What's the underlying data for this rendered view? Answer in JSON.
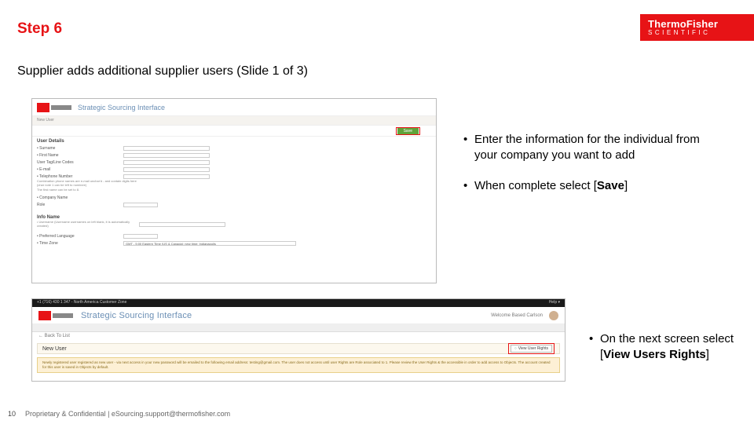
{
  "brand": {
    "line1": "ThermoFisher",
    "line2": "SCIENTIFIC"
  },
  "title": "Step 6",
  "subtitle": "Supplier adds additional supplier users (Slide 1 of 3)",
  "shot1": {
    "app_title": "Strategic Sourcing Interface",
    "crumb": "New User",
    "save_label": "Save",
    "section": "User Details",
    "rows": {
      "r1": "• Surname",
      "r2": "• First Name",
      "r3": "User Tag/Line Codes",
      "r4": "• E-mail",
      "r5": "• Telephone Number",
      "note1": "Combination phone names are e-mail unchar'd - and contain digits here (char note 1 can be left to nominee)",
      "note2": "The first name can be set to 8.",
      "r6": "• Company Name",
      "r7": "Role",
      "section2": "Info Name",
      "r8": "• Username (Username usernames on left blank, it is automatically created)",
      "r9": "• Preferred Language",
      "r10": "• Time Zone",
      "tz": "GMT - 5:00 Eastern Time (US & Canada); new time: Indianapolis"
    }
  },
  "shot2": {
    "black_left": "+1 (716) 430 1 347 - North America Customer Zone",
    "black_right": "Help ▾",
    "app_title": "Strategic Sourcing Interface",
    "welcome": "Welcome Based Carlson",
    "back": "← Back To List",
    "newuser": "New User",
    "viewrights": "View User Rights",
    "alert": "Newly registered user registered as new user - via next access in your new password will be emailed to the following email address: testing@gmail.com.\nThe user does not access until user Rights are Role associated to 1. Please review the User Rights & the accessible in order to add access to Objects. The account created for this user is saved in Objects by default."
  },
  "bullets1": {
    "b1": "Enter the information for the individual from your company you want to add",
    "b2_pre": "When complete select [",
    "b2_bold": "Save",
    "b2_post": "]"
  },
  "bullets2": {
    "b1_pre": "On the next screen select [",
    "b1_bold": "View Users Rights",
    "b1_post": "]"
  },
  "footer": {
    "page": "10",
    "text": "Proprietary & Confidential |  eSourcing.support@thermofisher.com"
  }
}
